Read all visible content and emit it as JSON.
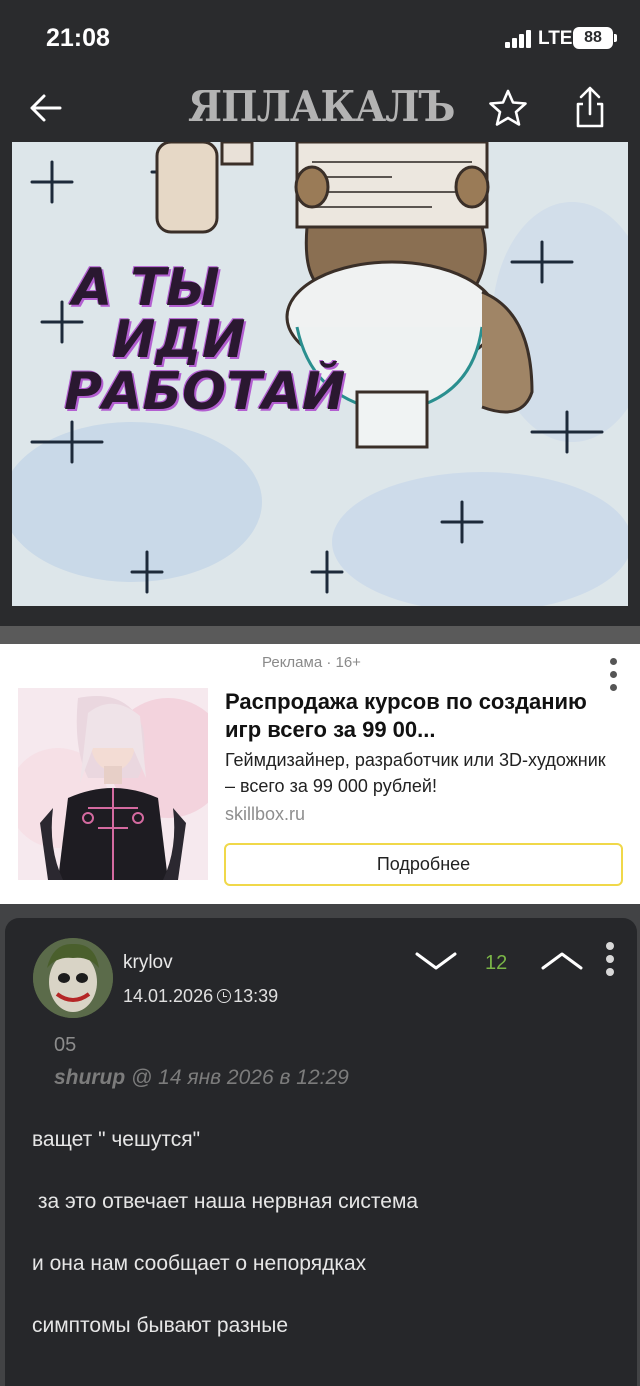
{
  "status_bar": {
    "time": "21:08",
    "network": "LTE",
    "battery": "88"
  },
  "nav": {
    "logo": "ЯПЛАКАЛЪ"
  },
  "post_image": {
    "lines": [
      "А ТЫ",
      "ИДИ",
      "РАБОТАЙ"
    ]
  },
  "ad": {
    "label": "Реклама · 16+",
    "title": "Распродажа курсов по созданию игр всего за 99 00...",
    "description": "Геймдизайнер, разработчик или 3D-художник – всего за 99 000 рублей!",
    "domain": "skillbox.ru",
    "button": "Подробнее"
  },
  "comment": {
    "username": "krylov",
    "date": "14.01.2026",
    "time": "13:39",
    "rating": "12",
    "quote_number": "05",
    "quote_user": "shurup",
    "quote_meta": "@ 14 янв 2026 в 12:29",
    "lines": [
      "ващет \" чешутся\"",
      " за это отвечает наша нервная система",
      "и она нам сообщает о непорядках",
      "симптомы бывают разные"
    ]
  },
  "colors": {
    "background": "#2a2b2d",
    "rating_green": "#7ab547",
    "ad_button_border": "#f0d84a"
  }
}
